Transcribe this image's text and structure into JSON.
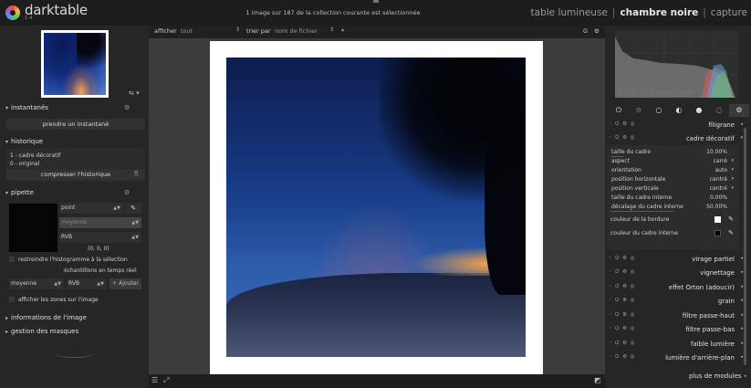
{
  "app": {
    "name": "darktable",
    "version": "1.4"
  },
  "header": {
    "collection_info": "1 image sur 187 de la collection courante est sélectionnée",
    "views": [
      {
        "label": "table lumineuse",
        "active": false
      },
      {
        "label": "chambre noire",
        "active": true
      },
      {
        "label": "capture",
        "active": false
      }
    ]
  },
  "left_panel": {
    "zoom_control": "⇆ ▾",
    "snapshots": {
      "title": "instantanés",
      "button": "prendre un instantané"
    },
    "history": {
      "title": "historique",
      "items": [
        "1 - cadre décoratif",
        "0 - original"
      ],
      "compress_button": "compresser l'historique"
    },
    "pipette": {
      "title": "pipette",
      "mode_value": "point",
      "size_value": "moyenne",
      "space_value": "RVB",
      "values": "(0, 0, 0)",
      "restrict_label": "restreindre l'histogramme à la sélection",
      "samples_label": "échantillons en temps réel",
      "sample_mode_value": "moyenne",
      "sample_space_value": "RVB",
      "add_button": "Ajouter",
      "show_zones_label": "afficher les zones sur l'image"
    },
    "image_info": {
      "title": "informations de l'image"
    },
    "mask_manager": {
      "title": "gestion des masques"
    }
  },
  "center_toolbar": {
    "show_label": "afficher",
    "show_value": "tout",
    "sort_label": "trier par",
    "sort_value": "nom de fichier",
    "right_icons": [
      "G",
      "⚙"
    ]
  },
  "right_panel": {
    "exif": "1/1,0\" f/2,1 0mm iso 80",
    "module_groups": [
      "⏻",
      "☆",
      "○",
      "◐",
      "●",
      "◌",
      "⚙"
    ],
    "modules_top": [
      {
        "name": "filigrane",
        "expanded": false
      },
      {
        "name": "cadre décoratif",
        "expanded": true
      }
    ],
    "frame_params": [
      {
        "key": "taille du cadre",
        "value": "10.00%",
        "fill": 0.1,
        "type": "slider"
      },
      {
        "key": "aspect",
        "value": "carré",
        "type": "combo"
      },
      {
        "key": "orientation",
        "value": "auto",
        "type": "combo"
      },
      {
        "key": "position horizontale",
        "value": "centré",
        "type": "combo"
      },
      {
        "key": "position verticale",
        "value": "centré",
        "type": "combo"
      },
      {
        "key": "taille du cadre interne",
        "value": "0.00%",
        "fill": 0.0,
        "type": "slider"
      },
      {
        "key": "décalage du cadre interne",
        "value": "50.00%",
        "fill": 0.5,
        "type": "slider"
      }
    ],
    "frame_colors": [
      {
        "key": "couleur de la bordure",
        "color": "#ffffff"
      },
      {
        "key": "couleur du cadre interne",
        "color": "#000000"
      }
    ],
    "modules_bottom": [
      "virage partiel",
      "vignettage",
      "effet Orton (adoucir)",
      "grain",
      "filtre passe-haut",
      "filtre passe-bas",
      "faible lumière",
      "lumière d'arrière-plan"
    ],
    "more_modules": "plus de modules"
  },
  "colors": {
    "accent_bg": "#262626",
    "center_bg": "#3c3c3c",
    "frame": "#ffffff"
  }
}
